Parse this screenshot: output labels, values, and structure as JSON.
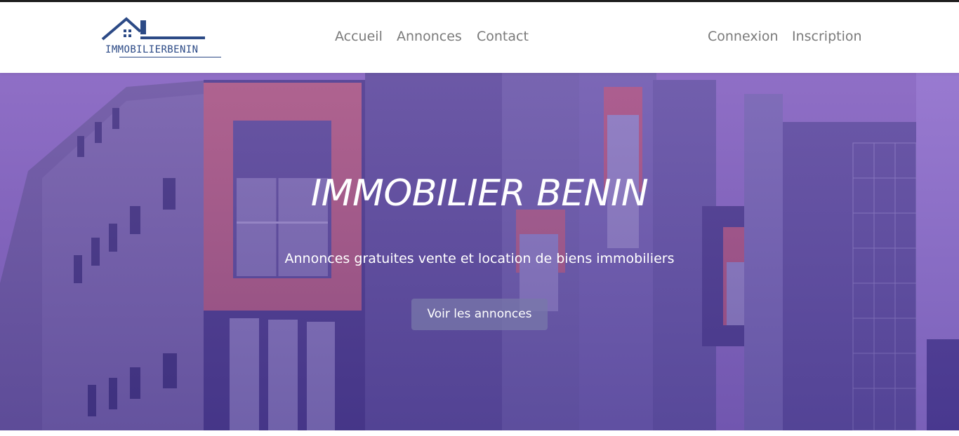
{
  "colors": {
    "brand": "#2c4a86",
    "nav_link": "#7a7a7a",
    "hero_top": "#9478c8",
    "hero_bottom": "#4d3b92",
    "button_bg": "#7878aa"
  },
  "logo": {
    "text": "IMMOBILIERBENIN",
    "icon": "house-roof-icon"
  },
  "nav": {
    "main": [
      {
        "label": "Accueil"
      },
      {
        "label": "Annonces"
      },
      {
        "label": "Contact"
      }
    ],
    "auth": [
      {
        "label": "Connexion"
      },
      {
        "label": "Inscription"
      }
    ]
  },
  "hero": {
    "title": "IMMOBILIER BENIN",
    "subtitle": "Annonces gratuites vente et location de biens immobiliers",
    "button_label": "Voir les annonces",
    "background": "building-photo"
  }
}
